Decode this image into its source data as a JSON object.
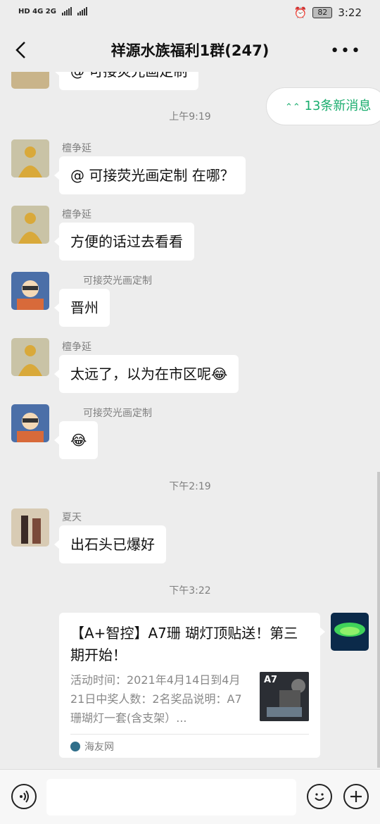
{
  "status": {
    "left": "HD 4G 2G",
    "battery": "82",
    "time": "3:22"
  },
  "header": {
    "title": "祥源水族福利1群(247)",
    "more": "•••"
  },
  "new_messages": "13条新消息",
  "messages": [
    {
      "type": "bubble",
      "text": "@        可接荧光画定制"
    },
    {
      "type": "time",
      "text": "上午9:19"
    },
    {
      "type": "msg",
      "name": "檀争延",
      "text": "@        可接荧光画定制 在哪？"
    },
    {
      "type": "msg",
      "name": "檀争延",
      "text": "方便的话过去看看"
    },
    {
      "type": "msg",
      "name": "可接荧光画定制",
      "text": "晋州"
    },
    {
      "type": "msg",
      "name": "檀争延",
      "text": "太远了，以为在市区呢"
    },
    {
      "type": "msg",
      "name": "可接荧光画定制",
      "text": ""
    },
    {
      "type": "time",
      "text": "下午2:19"
    },
    {
      "type": "msg",
      "name": "夏天",
      "text": "出石头已爆好"
    },
    {
      "type": "time",
      "text": "下午3:22"
    }
  ],
  "card": {
    "title": "【A+智控】A7珊 瑚灯顶贴送！第三期开始！",
    "desc": "活动时间：2021年4月14日到4月21日中奖人数：2名奖品说明：A7珊瑚灯一套(含支架）...",
    "thumb_text": "A7",
    "source": "海友网"
  },
  "colors": {
    "accent": "#1aad6e",
    "bubble": "#ffffff",
    "background": "#ededed"
  }
}
